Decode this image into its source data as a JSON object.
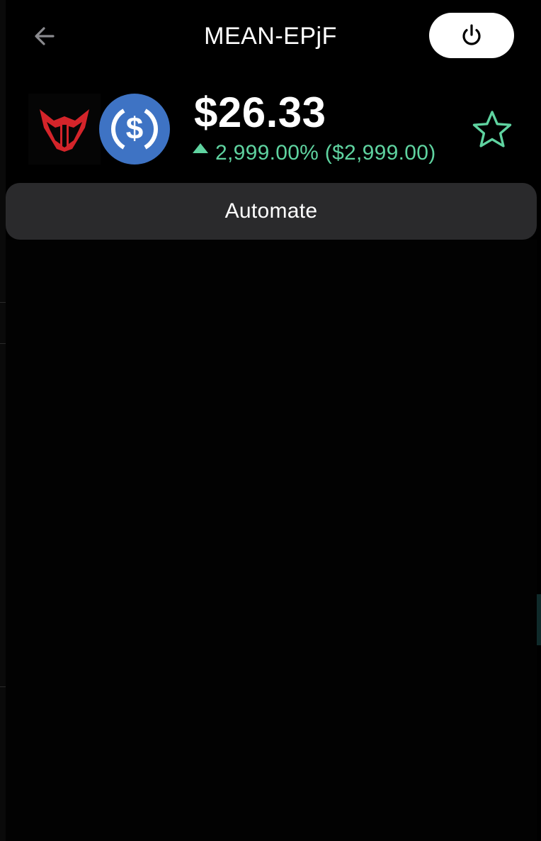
{
  "header": {
    "back_icon": "arrow-left-icon",
    "title": "MEAN-EPjF",
    "power_icon": "power-icon"
  },
  "token": {
    "base_logo_icon": "mean-logo-icon",
    "quote_logo_icon": "usdc-logo-icon",
    "price": "$26.33",
    "change_direction_icon": "triangle-up-icon",
    "change_text": "2,999.00% ($2,999.00)",
    "favorite_icon": "star-outline-icon"
  },
  "actions": {
    "automate_label": "Automate"
  },
  "colors": {
    "background": "#000000",
    "positive": "#5fd3a0",
    "button_bg": "#2a2a2c",
    "usdc_blue": "#3e73c4",
    "mean_red": "#d4242a",
    "back_icon_gray": "#8a8a8e",
    "power_btn_bg": "#ffffff"
  }
}
